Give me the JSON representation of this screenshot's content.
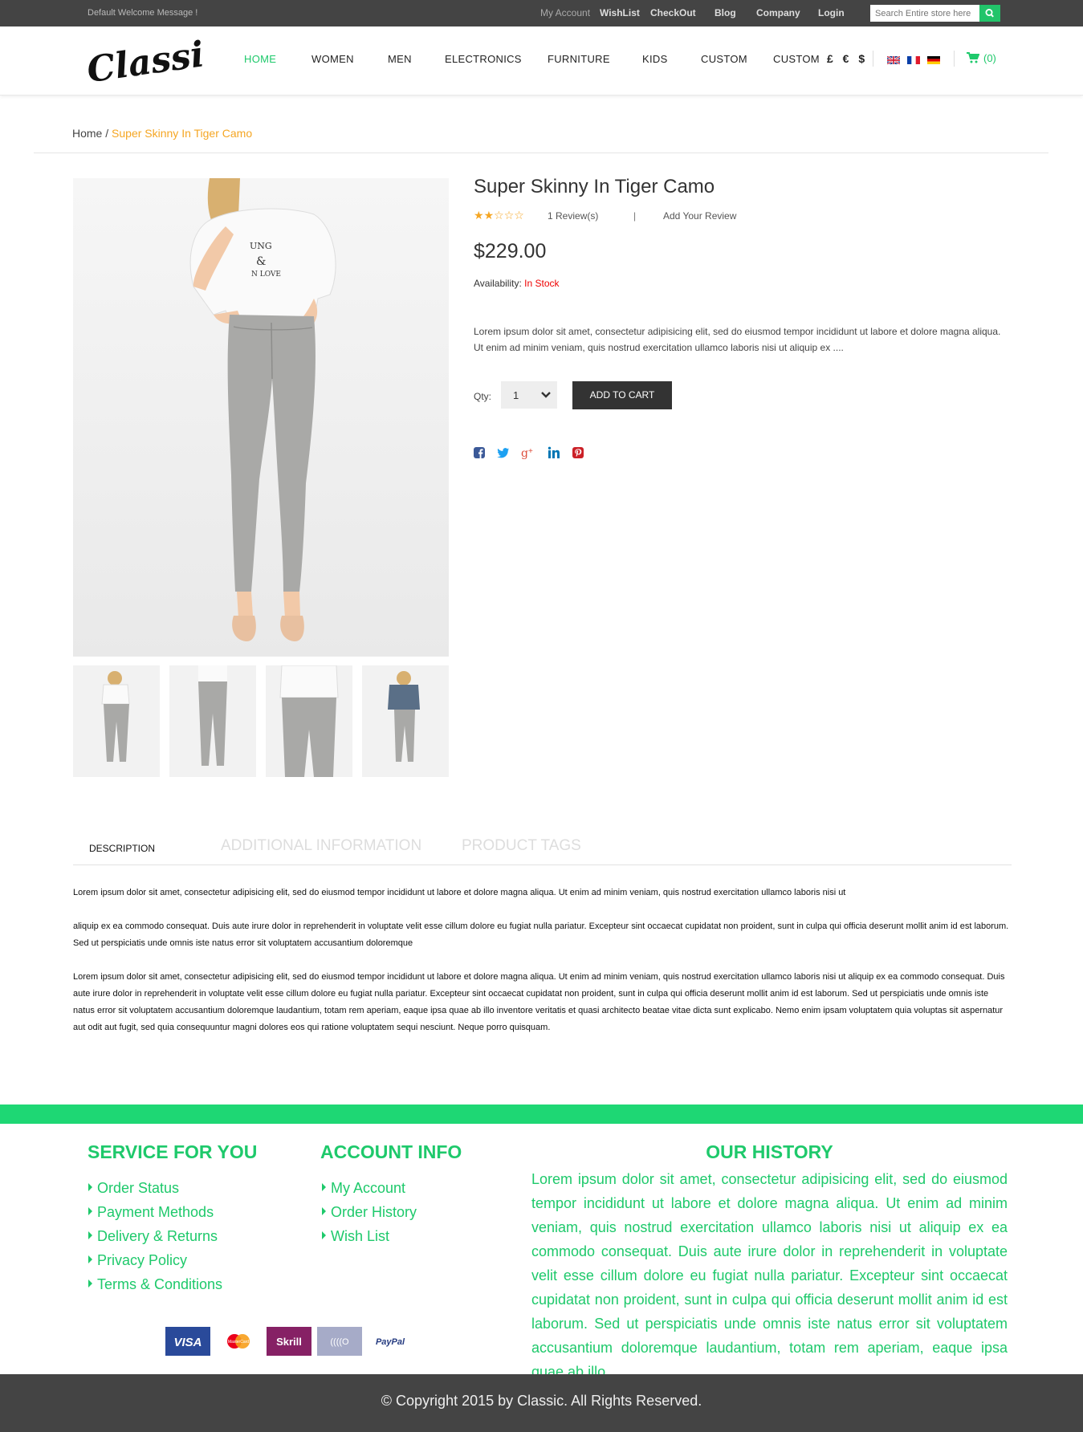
{
  "topbar": {
    "welcome": "Default Welcome Message !",
    "links": [
      "My Account",
      "WishList",
      "CheckOut",
      "Blog",
      "Company",
      "Login"
    ],
    "search_placeholder": "Search Entire store here"
  },
  "nav": {
    "items": [
      "HOME",
      "WOMEN",
      "MEN",
      "ELECTRONICS",
      "FURNITURE",
      "KIDS",
      "CUSTOM",
      "CUSTOM"
    ],
    "currency": "£ € $",
    "cart": "(0)"
  },
  "logo": {
    "text": "Classic"
  },
  "breadcrumb": {
    "home": "Home",
    "sep": " / ",
    "current": "Super Skinny In Tiger Camo"
  },
  "product": {
    "title": "Super Skinny In Tiger Camo",
    "rating": 2,
    "rating_max": 5,
    "reviews": "1 Review(s)",
    "pipe": "|",
    "add_review": "Add Your Review",
    "price": "$229.00",
    "availability_label": "Availability:",
    "availability_value": "In Stock",
    "short_desc": "Lorem ipsum dolor sit amet, consectetur adipisicing elit, sed do eiusmod tempor incididunt ut labore et dolore magna aliqua. Ut enim ad minim veniam, quis nostrud exercitation ullamco laboris nisi ut aliquip ex ....",
    "qty_label": "Qty:",
    "qty_value": "1",
    "add_to_cart": "ADD TO CART"
  },
  "tabs": [
    "DESCRIPTION",
    "ADDITIONAL INFORMATION",
    "PRODUCT TAGS"
  ],
  "description": [
    "Lorem ipsum dolor sit amet, consectetur adipisicing elit, sed do eiusmod tempor incididunt ut labore et dolore magna aliqua. Ut enim ad minim veniam, quis nostrud exercitation ullamco laboris nisi ut",
    "aliquip ex ea commodo consequat. Duis aute irure dolor in reprehenderit in voluptate velit esse cillum dolore eu fugiat nulla pariatur. Excepteur sint occaecat cupidatat non proident, sunt in culpa qui officia deserunt mollit anim id est laborum. Sed ut perspiciatis unde omnis iste natus error sit voluptatem accusantium doloremque",
    "Lorem ipsum dolor sit amet, consectetur adipisicing elit, sed do eiusmod tempor incididunt ut labore et dolore magna aliqua. Ut enim ad minim veniam, quis nostrud exercitation ullamco laboris nisi ut aliquip ex ea commodo consequat. Duis aute irure dolor in reprehenderit in voluptate velit esse cillum dolore eu fugiat nulla pariatur. Excepteur sint occaecat cupidatat non proident, sunt in culpa qui officia deserunt mollit anim id est laborum. Sed ut perspiciatis unde omnis iste natus error sit voluptatem accusantium doloremque laudantium, totam rem aperiam, eaque ipsa quae ab illo inventore veritatis et quasi architecto beatae vitae dicta sunt explicabo. Nemo enim ipsam voluptatem quia voluptas sit aspernatur aut odit aut fugit, sed quia consequuntur magni dolores eos qui ratione voluptatem sequi nesciunt. Neque porro quisquam."
  ],
  "footer": {
    "service_title": "SERVICE FOR YOU",
    "service_links": [
      "Order Status",
      "Payment Methods",
      "Delivery & Returns",
      "Privacy Policy",
      "Terms & Conditions"
    ],
    "account_title": "ACCOUNT INFO",
    "account_links": [
      "My Account",
      "Order History",
      "Wish List"
    ],
    "history_title": "OUR HISTORY",
    "history_text": "Lorem ipsum dolor sit amet, consectetur adipisicing elit, sed do eiusmod tempor incididunt ut labore et dolore magna aliqua. Ut enim ad minim veniam, quis nostrud exercitation ullamco laboris nisi ut aliquip ex ea commodo consequat. Duis aute irure dolor in reprehenderit in voluptate velit esse cillum dolore eu fugiat nulla pariatur. Excepteur sint occaecat cupidatat non proident, sunt in culpa qui officia deserunt mollit anim id est laborum. Sed ut perspiciatis unde omnis iste natus error sit voluptatem accusantium doloremque laudantium, totam rem aperiam, eaque ipsa quae ab illo.",
    "payments": [
      "VISA",
      "MasterCard",
      "Skrill",
      "((((O",
      "PayPal"
    ],
    "copyright": "© Copyright 2015 by Classic. All Rights Reserved."
  },
  "colors": {
    "accent": "#1ec96b",
    "topbar": "#444444",
    "breadcrumb_current": "#f5a623",
    "in_stock": "#ee0000"
  }
}
